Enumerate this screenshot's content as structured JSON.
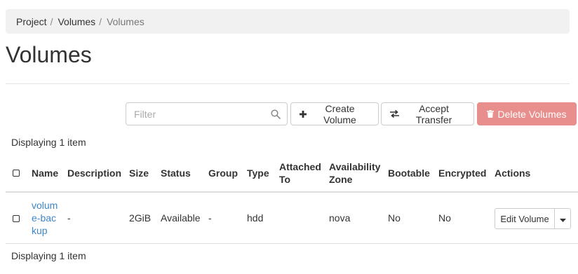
{
  "breadcrumb": {
    "items": [
      "Project",
      "Volumes"
    ],
    "active": "Volumes",
    "separator": "/"
  },
  "page": {
    "title": "Volumes"
  },
  "toolbar": {
    "filter_placeholder": "Filter",
    "create_label": "Create Volume",
    "transfer_label": "Accept Transfer",
    "delete_label": "Delete Volumes"
  },
  "table": {
    "count_text": "Displaying 1 item",
    "headers": {
      "name": "Name",
      "description": "Description",
      "size": "Size",
      "status": "Status",
      "group": "Group",
      "type": "Type",
      "attached_to": "Attached To",
      "availability_zone": "Availability Zone",
      "bootable": "Bootable",
      "encrypted": "Encrypted",
      "actions": "Actions"
    },
    "rows": [
      {
        "name": "volume-backup",
        "description": "-",
        "size": "2GiB",
        "status": "Available",
        "group": "-",
        "type": "hdd",
        "attached_to": "",
        "availability_zone": "nova",
        "bootable": "No",
        "encrypted": "No",
        "action_label": "Edit Volume"
      }
    ]
  },
  "colors": {
    "link": "#3d86c6",
    "danger_disabled": "#e88f8d",
    "breadcrumb_bg": "#f1f1f1"
  }
}
